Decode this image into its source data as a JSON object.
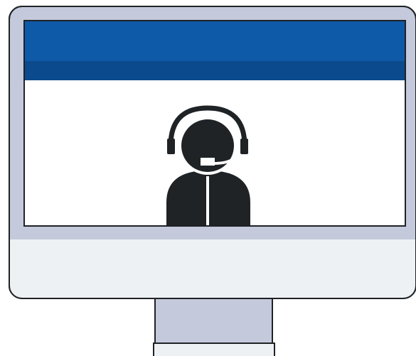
{
  "illustration": {
    "subject": "customer-support-agent",
    "icons": [
      "monitor-icon",
      "headset-icon",
      "person-icon",
      "microphone-icon"
    ]
  },
  "colors": {
    "outline": "#1f2326",
    "monitor_frame": "#c4cadb",
    "monitor_chin": "#eef1f4",
    "header_blue": "#0e5aa8",
    "header_blue_dark": "#0b4a8c",
    "screen_bg": "#ffffff",
    "figure": "#1f2326",
    "stand": "#c4cadb",
    "base": "#eef1f4"
  }
}
